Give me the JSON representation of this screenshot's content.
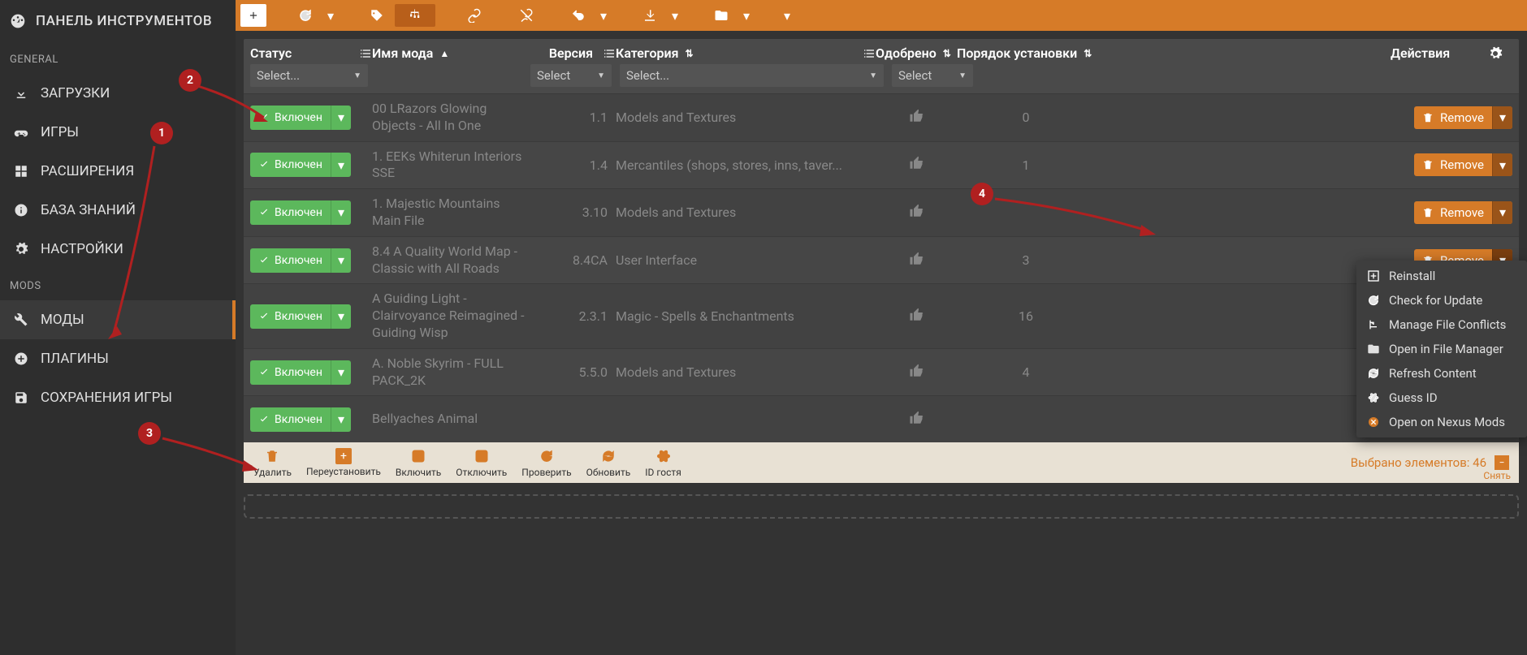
{
  "sidebar": {
    "title": "ПАНЕЛЬ ИНСТРУМЕНТОВ",
    "section_general": "GENERAL",
    "section_mods": "MODS",
    "items": {
      "downloads": "ЗАГРУЗКИ",
      "games": "ИГРЫ",
      "extensions": "РАСШИРЕНИЯ",
      "knowledge": "БАЗА ЗНАНИЙ",
      "settings": "НАСТРОЙКИ",
      "mods": "МОДЫ",
      "plugins": "ПЛАГИНЫ",
      "savegames": "СОХРАНЕНИЯ ИГРЫ"
    }
  },
  "columns": {
    "status": "Статус",
    "name": "Имя мода",
    "version": "Версия",
    "category": "Категория",
    "endorsed": "Одобрено",
    "order": "Порядок установки",
    "actions": "Действия"
  },
  "filters": {
    "select_placeholder": "Select..."
  },
  "buttons": {
    "enabled": "Включен",
    "remove": "Remove"
  },
  "menu": {
    "reinstall": "Reinstall",
    "check_update": "Check for Update",
    "conflicts": "Manage File Conflicts",
    "file_manager": "Open in File Manager",
    "refresh": "Refresh Content",
    "guess_id": "Guess ID",
    "open_nexus": "Open on Nexus Mods"
  },
  "rows": [
    {
      "name": "00 LRazors Glowing Objects - All In One",
      "version": "1.1",
      "category": "Models and Textures",
      "order": "0"
    },
    {
      "name": "1. EEKs Whiterun Interiors SSE",
      "version": "1.4",
      "category": "Mercantiles (shops, stores, inns, taver...",
      "order": "1"
    },
    {
      "name": "1. Majestic Mountains Main File",
      "version": "3.10",
      "category": "Models and Textures",
      "order": ""
    },
    {
      "name": "8.4 A Quality World Map - Classic with All Roads",
      "version": "8.4CA",
      "category": "User Interface",
      "order": "3"
    },
    {
      "name": "A Guiding Light - Clairvoyance Reimagined - Guiding Wisp",
      "version": "2.3.1",
      "category": "Magic - Spells & Enchantments",
      "order": "16"
    },
    {
      "name": "A. Noble Skyrim - FULL PACK_2K",
      "version": "5.5.0",
      "category": "Models and Textures",
      "order": "4"
    },
    {
      "name": "Bellyaches Animal",
      "version": "",
      "category": "",
      "order": ""
    }
  ],
  "footer": {
    "remove": "Удалить",
    "reinstall": "Переустановить",
    "enable": "Включить",
    "disable": "Отключить",
    "check": "Проверить",
    "update": "Обновить",
    "guest_id": "ID гостя",
    "selected_count": "Выбрано элементов: 46",
    "deselect": "Снять"
  },
  "annotations": {
    "a1": "1",
    "a2": "2",
    "a3": "3",
    "a4": "4"
  }
}
